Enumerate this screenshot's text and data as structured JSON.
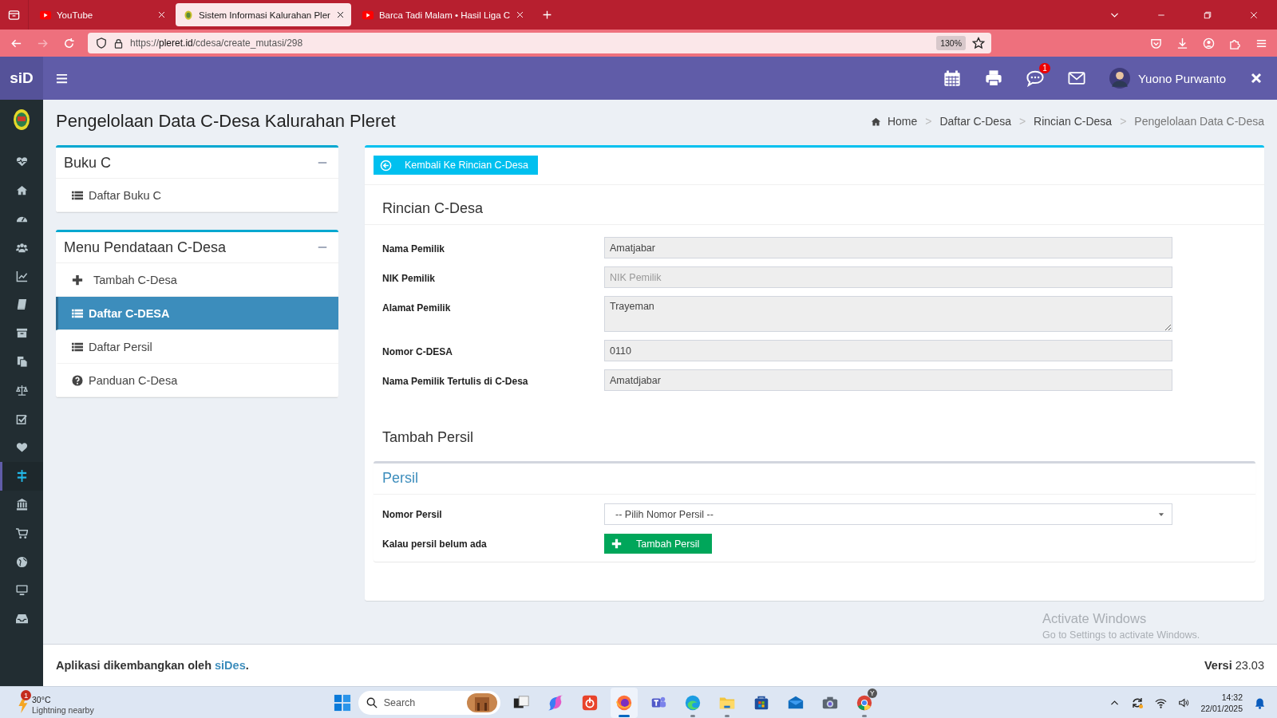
{
  "browser": {
    "tabs": [
      {
        "title": "YouTube",
        "kind": "video",
        "selected": false
      },
      {
        "title": "Sistem Informasi Kalurahan Pler",
        "kind": "emblem",
        "selected": true
      },
      {
        "title": "Barca Tadi Malam • Hasil Liga C",
        "kind": "video",
        "selected": false
      }
    ],
    "url": {
      "scheme": "https://",
      "host": "pleret.id",
      "path": "/cdesa/create_mutasi/298"
    },
    "zoom": "130%"
  },
  "header": {
    "brand": "siD",
    "user": "Yuono Purwanto",
    "message_badge": "1"
  },
  "sidebar": [
    {
      "kind": "heartbeat",
      "selected": false
    },
    {
      "kind": "home",
      "selected": false
    },
    {
      "kind": "gauge",
      "selected": false
    },
    {
      "kind": "users",
      "selected": false
    },
    {
      "kind": "chart",
      "selected": false
    },
    {
      "kind": "book",
      "selected": false
    },
    {
      "kind": "archive",
      "selected": false
    },
    {
      "kind": "files",
      "selected": false
    },
    {
      "kind": "scale",
      "selected": false
    },
    {
      "kind": "checkbox",
      "selected": false
    },
    {
      "kind": "heart",
      "selected": false
    },
    {
      "kind": "signpost",
      "selected": true
    },
    {
      "kind": "bank",
      "selected": false
    },
    {
      "kind": "cart",
      "selected": false
    },
    {
      "kind": "globe",
      "selected": false
    },
    {
      "kind": "monitor",
      "selected": false
    },
    {
      "kind": "inbox",
      "selected": false
    }
  ],
  "page_title": "Pengelolaan Data C-Desa Kalurahan Pleret",
  "breadcrumb_separator": ">",
  "breadcrumb": [
    {
      "label": "Home",
      "kind": "home",
      "current": false
    },
    {
      "label": "Daftar C-Desa",
      "current": false
    },
    {
      "label": "Rincian C-Desa",
      "current": false
    },
    {
      "label": "Pengelolaan Data C-Desa",
      "current": true
    }
  ],
  "menu_panels": [
    {
      "title": "Buku C",
      "items": [
        {
          "label": "Daftar Buku C",
          "kind": "list",
          "selected": false
        }
      ]
    },
    {
      "title": "Menu Pendataan C-Desa",
      "items": [
        {
          "label": "Tambah C-Desa",
          "kind": "plus",
          "selected": false
        },
        {
          "label": "Daftar C-DESA",
          "kind": "list",
          "selected": true
        },
        {
          "label": "Daftar Persil",
          "kind": "list",
          "selected": false
        },
        {
          "label": "Panduan C-Desa",
          "kind": "question",
          "selected": false
        }
      ]
    }
  ],
  "back_button": "Kembali Ke Rincian C-Desa",
  "details": {
    "title": "Rincian C-Desa",
    "fields": [
      {
        "label": "Nama Pemilik",
        "kind": "input",
        "value": "Amatjabar"
      },
      {
        "label": "NIK Pemilik",
        "kind": "input",
        "placeholder": "NIK Pemilik"
      },
      {
        "label": "Alamat Pemilik",
        "kind": "textarea",
        "value": "Trayeman"
      },
      {
        "label": "Nomor C-DESA",
        "kind": "input",
        "value": "0110"
      },
      {
        "label": "Nama Pemilik Tertulis di C-Desa",
        "kind": "input",
        "value": "Amatdjabar"
      }
    ]
  },
  "add_persil": {
    "title": "Tambah Persil",
    "box_title": "Persil",
    "rows": [
      {
        "label": "Nomor Persil",
        "kind": "select",
        "value": "-- Pilih Nomor Persil --"
      },
      {
        "label": "Kalau persil belum ada",
        "kind": "button",
        "value": "Tambah Persil"
      }
    ]
  },
  "footer": {
    "credit": "Aplikasi dikembangkan oleh",
    "link": "siDes",
    "credit_end": ".",
    "version": "**Versi** 23.03"
  },
  "windows_notice": {
    "title": "Activate Windows",
    "text": "Go to Settings to activate Windows."
  },
  "taskbar": {
    "weather": {
      "temp": "30°C",
      "text": "Lightning nearby",
      "badge": "1"
    },
    "search": {
      "placeholder": "Search"
    },
    "apps": [
      {
        "kind": "task-view",
        "running": false,
        "selected": false
      },
      {
        "kind": "assistant",
        "running": false,
        "selected": false
      },
      {
        "kind": "office",
        "running": false,
        "selected": false
      },
      {
        "kind": "browser-fox",
        "running": true,
        "selected": true
      },
      {
        "kind": "chat",
        "running": false,
        "selected": false
      },
      {
        "kind": "browser-wave",
        "running": true,
        "selected": false
      },
      {
        "kind": "folder",
        "running": true,
        "selected": false
      },
      {
        "kind": "store",
        "running": false,
        "selected": false
      },
      {
        "kind": "mail",
        "running": false,
        "selected": false
      },
      {
        "kind": "camera",
        "running": false,
        "selected": false
      },
      {
        "kind": "browser-ring",
        "running": true,
        "selected": false,
        "badge": "Y"
      }
    ],
    "clock": {
      "time": "14:32",
      "date": "22/01/2025"
    }
  }
}
